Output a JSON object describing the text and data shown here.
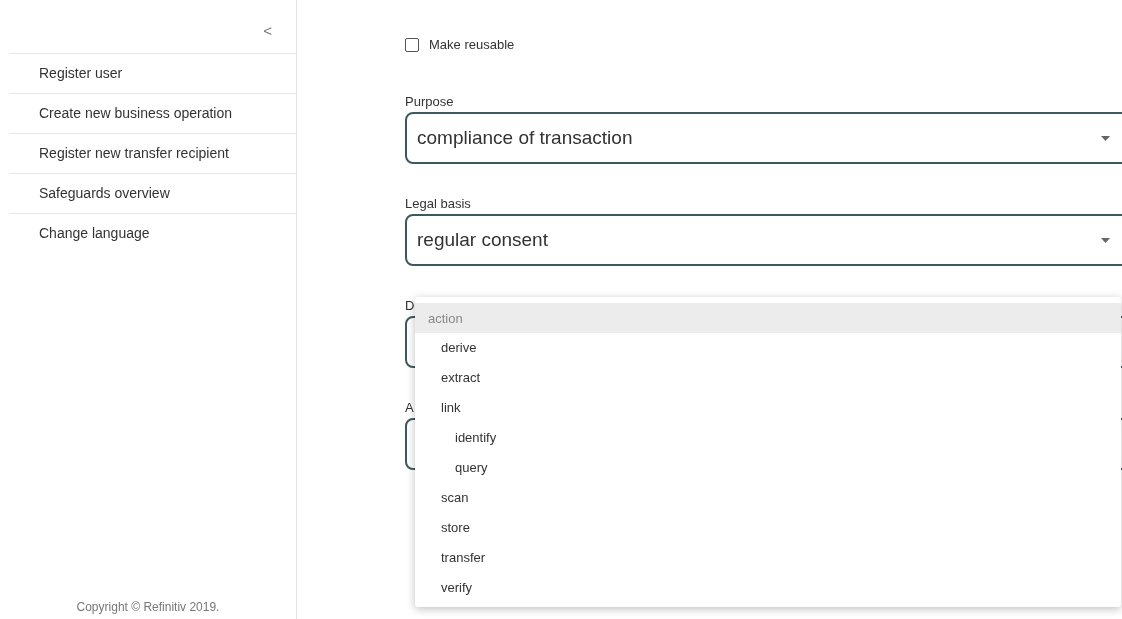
{
  "sidebar": {
    "collapse_icon": "<",
    "items": [
      {
        "label": "Register user"
      },
      {
        "label": "Create new business operation"
      },
      {
        "label": "Register new transfer recipient"
      },
      {
        "label": "Safeguards overview"
      },
      {
        "label": "Change language"
      }
    ],
    "footer": "Copyright © Refinitiv 2019."
  },
  "form": {
    "reusable": {
      "label": "Make reusable",
      "checked": false
    },
    "fields": [
      {
        "label": "Purpose",
        "value": "compliance of transaction"
      },
      {
        "label": "Legal basis",
        "value": "regular consent"
      },
      {
        "label": "D"
      },
      {
        "label": "A"
      }
    ]
  },
  "dropdown": {
    "header": "action",
    "options": [
      {
        "label": "derive"
      },
      {
        "label": "extract"
      },
      {
        "label": "link",
        "children": [
          {
            "label": "identify"
          },
          {
            "label": "query"
          }
        ]
      },
      {
        "label": "scan"
      },
      {
        "label": "store"
      },
      {
        "label": "transfer"
      },
      {
        "label": "verify"
      }
    ]
  }
}
